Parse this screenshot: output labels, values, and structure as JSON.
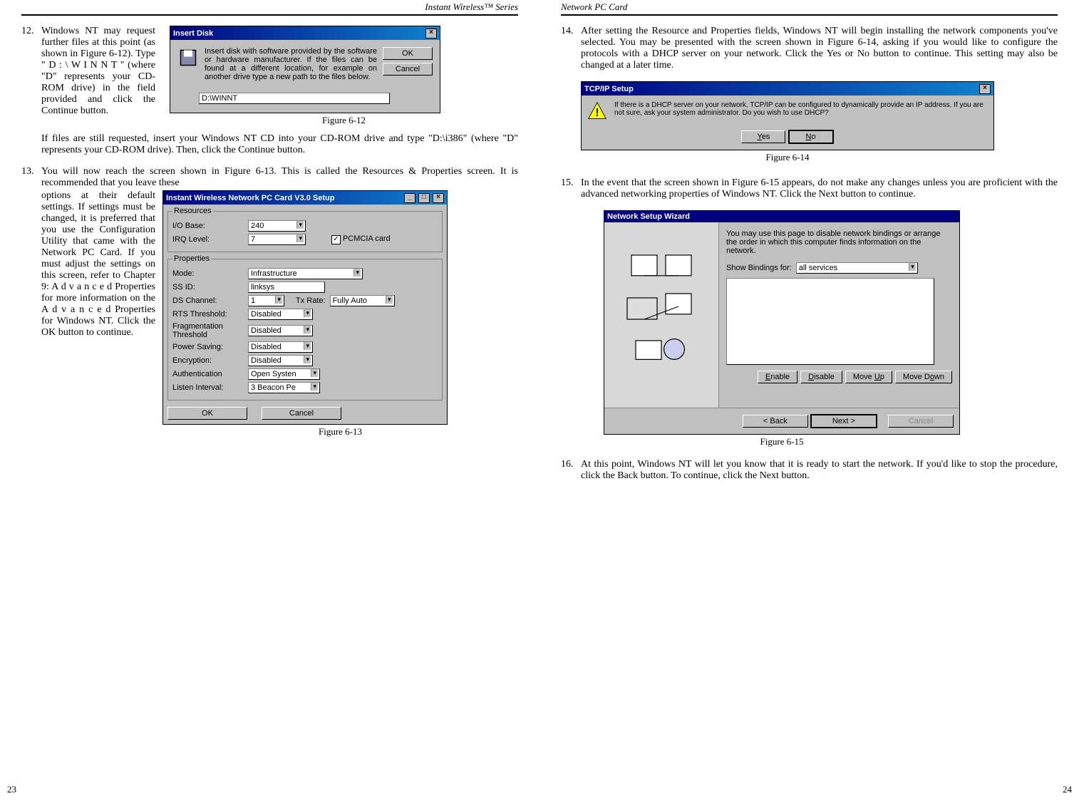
{
  "headers": {
    "left": "Instant Wireless™ Series",
    "right": "Network PC Card"
  },
  "page_numbers": {
    "left": "23",
    "right": "24"
  },
  "steps": {
    "s12_num": "12.",
    "s12_narrow": "Windows NT may request further files at this point (as shown in Figure 6-12). Type \" D : \\ W I N N T \" (where \"D\" repre­sents your CD-ROM drive) in the field provided and click the Continue button.",
    "s12_after": "If files are still requested, insert your Windows NT CD into your CD-ROM drive and type \"D:\\i386\" (where \"D\" represents your CD-ROM drive). Then, click the Continue button.",
    "s13_num": "13.",
    "s13_intro": "You will now reach the screen shown in Figure 6-13. This is called the Resources & Properties screen. It is recommended that you leave these",
    "s13_narrow": "options at their default settings. If settings must be changed, it is pre­ferred that you use the Configuration Utility that came with the Network PC Card.   If you must adjust the set­tings on this screen, refer to Chapter 9: A d v a n c e d Properties for more information on the A d v a n c e d Properties for Windows NT. Click the OK button to continue.",
    "s14_num": "14.",
    "s14_text": "After setting the Resource and Properties fields, Windows NT will begin installing the network components you've selected. You may be presented with the screen shown in Figure 6-14, asking if you would like to configure the protocols with a DHCP server on your network. Click the Yes or No button to continue.  This setting may also be changed at a later time.",
    "s15_num": "15.",
    "s15_text": "In the event that the screen shown in Figure 6-15 appears, do not make any changes unless you are proficient with the advanced networking properties of Windows NT. Click the Next button to continue.",
    "s16_num": "16.",
    "s16_text": "At this point, Windows NT will let you know that it is ready to start the net­work. If you'd like to stop the procedure, click the Back button. To contin­ue, click the Next button."
  },
  "figures": {
    "f612": "Figure 6-12",
    "f613": "Figure 6-13",
    "f614": "Figure 6-14",
    "f615": "Figure 6-15"
  },
  "dlg612": {
    "title": "Insert Disk",
    "msg": "Insert disk with software provided by the software or hardware manufacturer.  If the files can be found at a different location, for example on another drive type a new path to the files below.",
    "path": "D:\\WINNT",
    "ok": "OK",
    "cancel": "Cancel"
  },
  "dlg613": {
    "title": "Instant Wireless Network PC Card V3.0 Setup",
    "grp_res": "Resources",
    "grp_prop": "Properties",
    "lbl_io": "I/O Base:",
    "val_io": "240",
    "lbl_irq": "IRQ Level:",
    "val_irq": "7",
    "lbl_pcmcia": "PCMCIA card",
    "lbl_mode": "Mode:",
    "val_mode": "Infrastructure",
    "lbl_ssid": "SS ID:",
    "val_ssid": "linksys",
    "lbl_ds": "DS Channel:",
    "val_ds": "1",
    "lbl_tx": "Tx Rate:",
    "val_tx": "Fully Auto",
    "lbl_rts": "RTS Threshold:",
    "val_rts": "Disabled",
    "lbl_frag": "Fragmentation Threshold",
    "val_frag": "Disabled",
    "lbl_power": "Power Saving:",
    "val_power": "Disabled",
    "lbl_enc": "Encryption:",
    "val_enc": "Disabled",
    "lbl_auth": "Authentication",
    "val_auth": "Open Systen",
    "lbl_listen": "Listen Interval:",
    "val_listen": "3 Beacon Pe",
    "ok": "OK",
    "cancel": "Cancel"
  },
  "dlg614": {
    "title": "TCP/IP Setup",
    "msg": "If there is a DHCP server on your network, TCP/IP can be configured to dynamically provide an IP address.  If you are not sure, ask your system administrator.  Do you wish to use DHCP?",
    "yes": "Yes",
    "no": "No"
  },
  "dlg615": {
    "title": "Network Setup Wizard",
    "intro": "You may use this page to disable network bindings or arrange the order in which this computer finds information on the network.",
    "lbl_show": "Show Bindings for:",
    "val_show": "all services",
    "enable": "Enable",
    "disable": "Disable",
    "moveup": "Move Up",
    "movedown": "Move Down",
    "back": "< Back",
    "next": "Next >",
    "cancel": "Cancel"
  }
}
